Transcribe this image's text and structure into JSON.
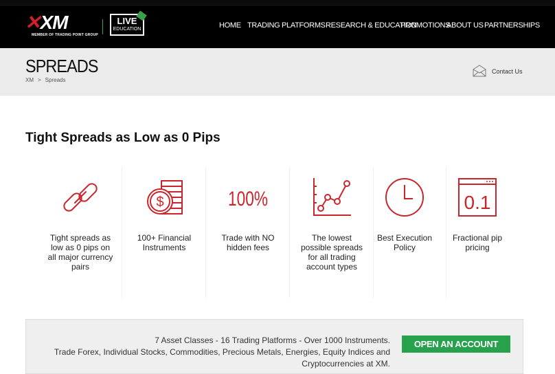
{
  "header": {
    "logo_text": "XM",
    "logo_subtitle": "MEMBER OF TRADING POINT GROUP",
    "badge_line1": "LIVE",
    "badge_line2": "EDUCATION",
    "nav": [
      {
        "label": "HOME"
      },
      {
        "label": "TRADING"
      },
      {
        "label": "PLATFORMS"
      },
      {
        "label": "RESEARCH & EDUCATION"
      },
      {
        "label": "PROMOTIONS"
      },
      {
        "label": "ABOUT US"
      },
      {
        "label": "PARTNERSHIPS"
      }
    ]
  },
  "title_band": {
    "title": "SPREADS",
    "breadcrumb_home": "XM",
    "breadcrumb_sep": ">",
    "breadcrumb_current": "Spreads",
    "contact_label": "Contact Us"
  },
  "section": {
    "title": "Tight Spreads as Low as 0 Pips"
  },
  "features": [
    {
      "icon": "chain-link-icon",
      "label": "Tight spreads as low as 0 pips on all major currency pairs"
    },
    {
      "icon": "coin-stack-icon",
      "label": "100+ Financial Instruments"
    },
    {
      "icon": "percent-icon",
      "icon_text": "100%",
      "label": "Trade with NO hidden fees"
    },
    {
      "icon": "line-chart-icon",
      "label": "The lowest possible spreads for all trading account types"
    },
    {
      "icon": "clock-icon",
      "label": "Best Execution Policy"
    },
    {
      "icon": "pip-display-icon",
      "icon_text": "0.1",
      "label": "Fractional pip pricing"
    }
  ],
  "cta": {
    "line1": "7 Asset Classes - 16 Trading Platforms - Over 1000 Instruments.",
    "line2": "Trade Forex, Individual Stocks, Commodities, Precious Metals, Energies, Equity Indices and Cryptocurrencies at XM.",
    "button_label": "OPEN AN ACCOUNT"
  },
  "colors": {
    "accent_red": "#c9262c",
    "cta_green": "#27a14b",
    "nav_bg": "#000000"
  }
}
